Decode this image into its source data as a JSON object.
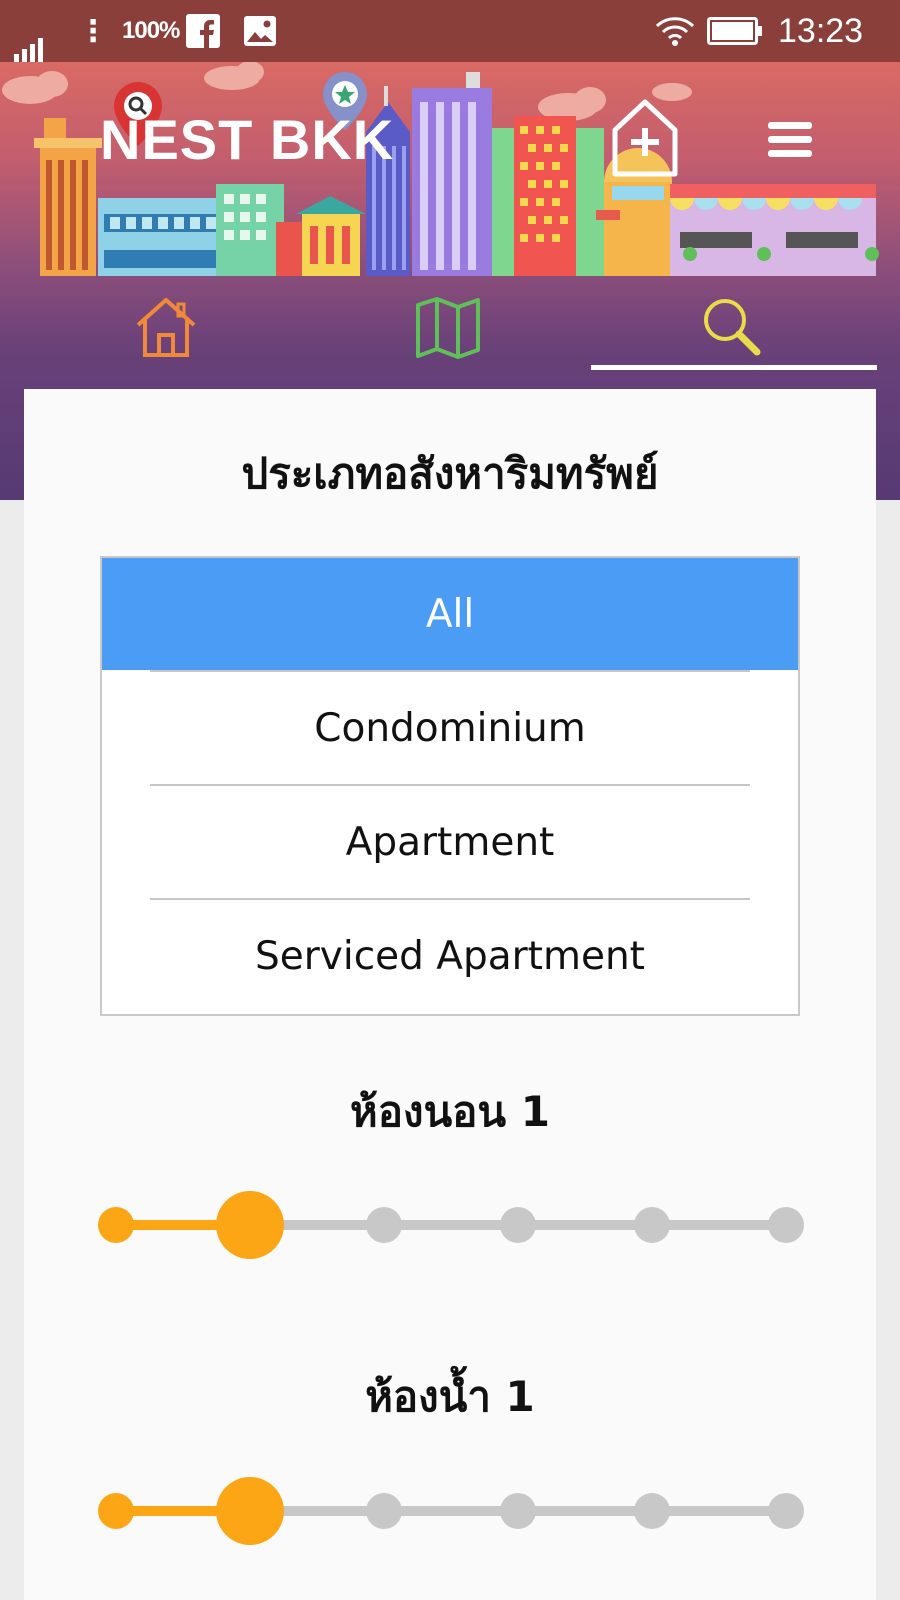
{
  "status_bar": {
    "battery_percent": "100%",
    "time": "13:23"
  },
  "header": {
    "app_name": "NEST BKK",
    "add_icon": "home-plus-icon",
    "menu_icon": "hamburger-menu-icon"
  },
  "nav_tabs": [
    {
      "id": "home",
      "icon": "home-icon",
      "color": "#f08a3a"
    },
    {
      "id": "map",
      "icon": "map-icon",
      "color": "#5fbf59"
    },
    {
      "id": "search",
      "icon": "search-icon",
      "color": "#e8dc4a",
      "selected": true
    }
  ],
  "filters": {
    "property_type_title": "ประเภทอสังหาริมทรัพย์",
    "property_types": [
      {
        "label": "All",
        "selected": true
      },
      {
        "label": "Condominium",
        "selected": false
      },
      {
        "label": "Apartment",
        "selected": false
      },
      {
        "label": "Serviced Apartment",
        "selected": false
      }
    ],
    "bedrooms": {
      "title": "ห้องนอน 1",
      "value": 1,
      "levels": 6
    },
    "bathrooms": {
      "title": "ห้องน้ำ 1",
      "value": 1,
      "levels": 6
    }
  },
  "colors": {
    "accent": "#4a9cf5",
    "slider_active": "#fca515",
    "slider_inactive": "#c8c8c8"
  }
}
